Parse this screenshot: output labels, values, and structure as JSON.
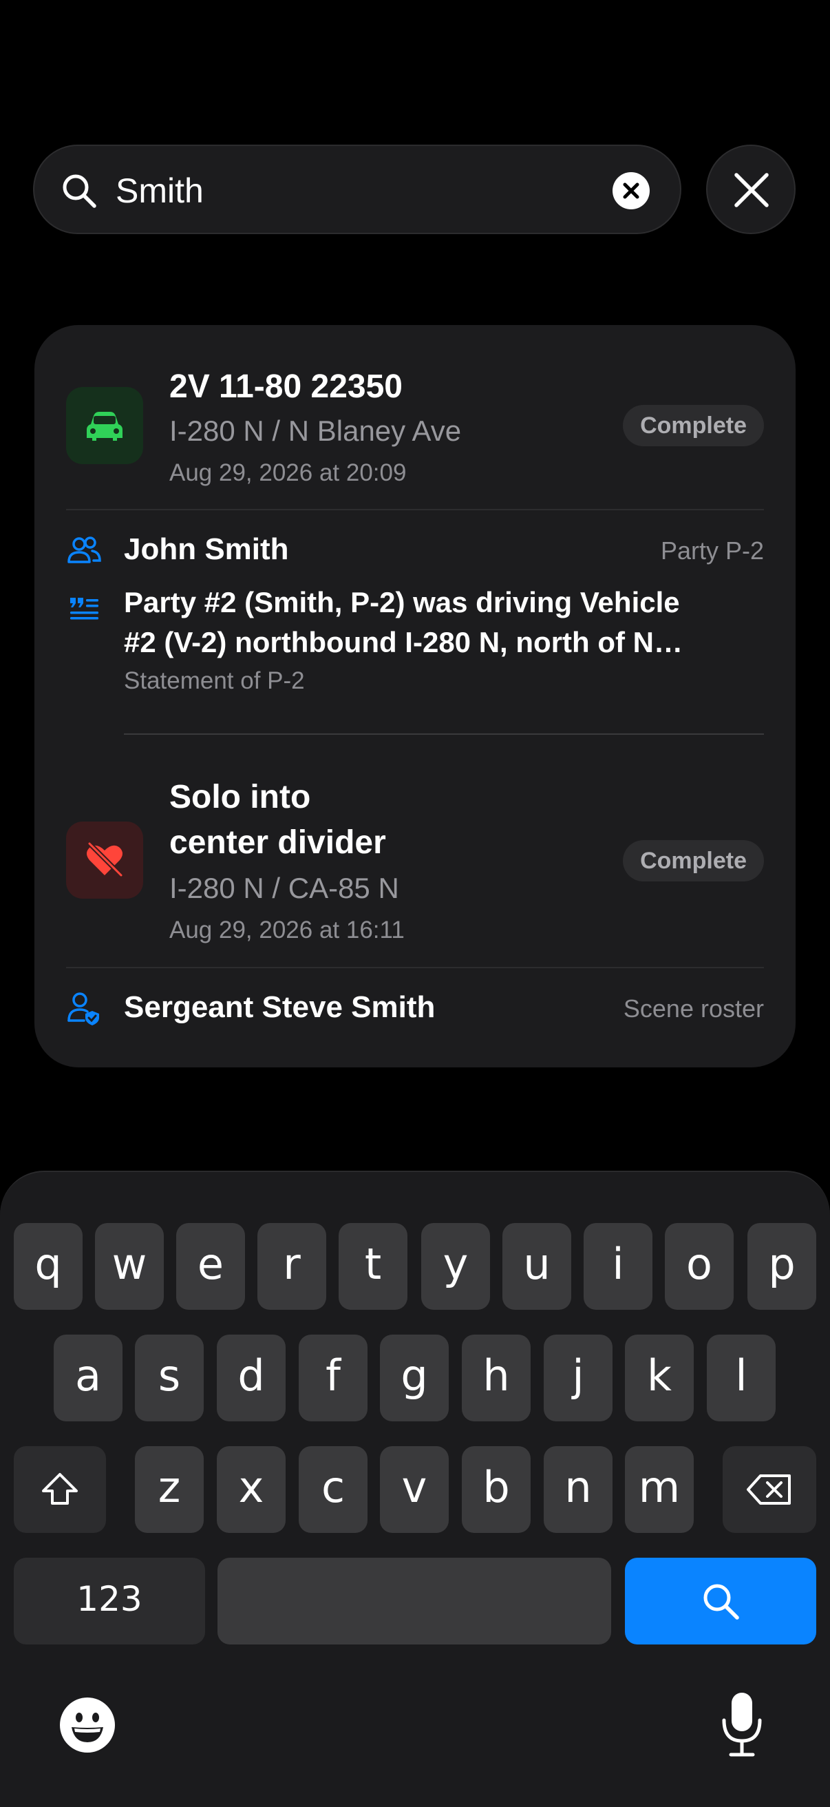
{
  "search": {
    "query": "Smith"
  },
  "results": [
    {
      "title": "2V 11-80 22350",
      "location": "I-280 N / N Blaney Ave",
      "timestamp": "Aug 29, 2026 at 20:09",
      "status": "Complete",
      "icon": "car-icon",
      "accent": "#30d158",
      "matches": [
        {
          "type": "party",
          "icon": "people-icon",
          "name": "John Smith",
          "tag": "Party P-2"
        },
        {
          "type": "statement",
          "icon": "quote-icon",
          "text_line1": "Party #2 (Smith, P-2) was driving Vehicle",
          "text_line2": "#2 (V-2) northbound I-280 N, north of N…",
          "source": "Statement of P-2"
        }
      ]
    },
    {
      "title_line1": "Solo into",
      "title_line2": "center divider",
      "location": "I-280 N / CA-85 N",
      "timestamp": "Aug 29, 2026 at 16:11",
      "status": "Complete",
      "icon": "broken-heart-icon",
      "accent": "#ff453a",
      "matches": [
        {
          "type": "roster",
          "icon": "person-badge-icon",
          "name": "Sergeant Steve Smith",
          "tag": "Scene roster"
        }
      ]
    }
  ],
  "keyboard": {
    "row1": [
      "q",
      "w",
      "e",
      "r",
      "t",
      "y",
      "u",
      "i",
      "o",
      "p"
    ],
    "row2": [
      "a",
      "s",
      "d",
      "f",
      "g",
      "h",
      "j",
      "k",
      "l"
    ],
    "row3": [
      "z",
      "x",
      "c",
      "v",
      "b",
      "n",
      "m"
    ],
    "numbers_label": "123",
    "space_label": "",
    "accent": "#0a84ff"
  }
}
